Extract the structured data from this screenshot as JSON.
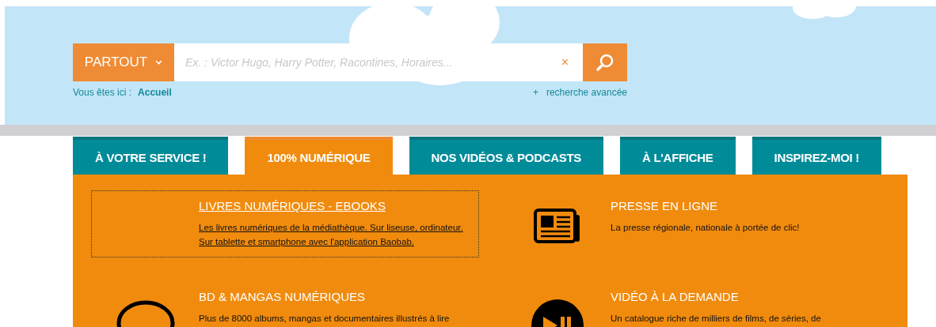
{
  "search": {
    "scope": "PARTOUT",
    "placeholder": "Ex. : Victor Hugo, Harry Potter, Racontines, Horaires...",
    "clear": "×"
  },
  "breadcrumb": {
    "label": "Vous êtes ici :",
    "current": "Accueil"
  },
  "advanced": {
    "plus": "+",
    "label": "recherche avancée"
  },
  "tabs": [
    {
      "label": "À VOTRE SERVICE !",
      "selected": false
    },
    {
      "label": "100% NUMÉRIQUE",
      "selected": true
    },
    {
      "label": "NOS VIDÉOS & PODCASTS",
      "selected": false
    },
    {
      "label": "À L'AFFICHE",
      "selected": false
    },
    {
      "label": "INSPIREZ-MOI !",
      "selected": false
    }
  ],
  "items": [
    {
      "kind": "none",
      "title": "LIVRES NUMÉRIQUES - EBOOKS",
      "text": "Les livres numériques de la médiathèque. Sur liseuse, ordinateur. Sur tablette et smartphone avec l'application Baobab.",
      "focused": true
    },
    {
      "kind": "newspaper",
      "title": "PRESSE EN LIGNE",
      "text": "La presse régionale, nationale à portée de clic!",
      "focused": false
    },
    {
      "kind": "bubble",
      "title": "BD & MANGAS NUMÉRIQUES",
      "text": "Plus de 8000 albums, mangas et documentaires illustrés à lire",
      "focused": false
    },
    {
      "kind": "play",
      "title": "VIDÉO À LA DEMANDE",
      "text": "Un catalogue riche de milliers de films, de séries, de",
      "focused": false
    }
  ]
}
